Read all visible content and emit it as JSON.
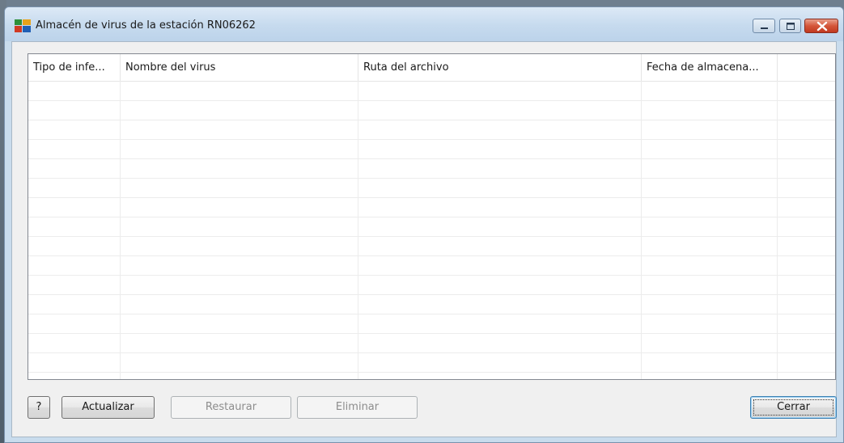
{
  "window": {
    "title": "Almacén de virus de la estación RN06262",
    "icon": "avg-logo-icon"
  },
  "caption_buttons": [
    "minimize-icon",
    "maximize-icon",
    "close-icon"
  ],
  "table": {
    "columns": [
      {
        "label": "Tipo de infe..."
      },
      {
        "label": "Nombre del virus"
      },
      {
        "label": "Ruta del archivo"
      },
      {
        "label": "Fecha de almacena..."
      },
      {
        "label": ""
      }
    ],
    "rows": []
  },
  "buttons": {
    "help": "?",
    "refresh": "Actualizar",
    "restore": "Restaurar",
    "delete": "Eliminar",
    "close": "Cerrar"
  },
  "colors": {
    "titlebar": "#c6daee",
    "close_button": "#c0391f",
    "default_button_border": "#3c7fb1"
  }
}
